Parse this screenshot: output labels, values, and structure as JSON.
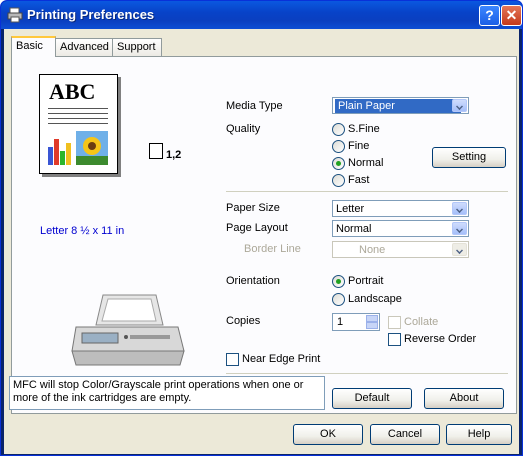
{
  "window": {
    "title": "Printing Preferences"
  },
  "tabs": [
    {
      "label": "Basic"
    },
    {
      "label": "Advanced"
    },
    {
      "label": "Support"
    }
  ],
  "preview": {
    "abc_text": "ABC",
    "copies_text": "1,2",
    "paper_text": "Letter 8 ½ x 11 in"
  },
  "media_type": {
    "label": "Media Type",
    "value": "Plain Paper"
  },
  "quality": {
    "label": "Quality",
    "options": [
      "S.Fine",
      "Fine",
      "Normal",
      "Fast"
    ],
    "selected": "Normal",
    "setting_button": "Setting"
  },
  "paper_size": {
    "label": "Paper Size",
    "value": "Letter"
  },
  "page_layout": {
    "label": "Page Layout",
    "value": "Normal"
  },
  "border_line": {
    "label": "Border Line",
    "value": "None"
  },
  "orientation": {
    "label": "Orientation",
    "options": [
      "Portrait",
      "Landscape"
    ],
    "selected": "Portrait"
  },
  "copies": {
    "label": "Copies",
    "value": "1",
    "collate_label": "Collate",
    "reverse_label": "Reverse Order"
  },
  "near_edge": {
    "label": "Near Edge Print"
  },
  "status_text": "MFC will stop Color/Grayscale print operations when one or more of the ink cartridges are empty.",
  "buttons": {
    "default": "Default",
    "about": "About",
    "ok": "OK",
    "cancel": "Cancel",
    "help": "Help"
  },
  "icons": [
    "printer-icon",
    "help-icon",
    "close-icon",
    "copies-icon",
    "mfc-printer-icon"
  ],
  "colors": {
    "titlebar": "#0a46d4",
    "client": "#ece9d8",
    "link_blue": "#0000d0",
    "selection": "#316ac5"
  }
}
